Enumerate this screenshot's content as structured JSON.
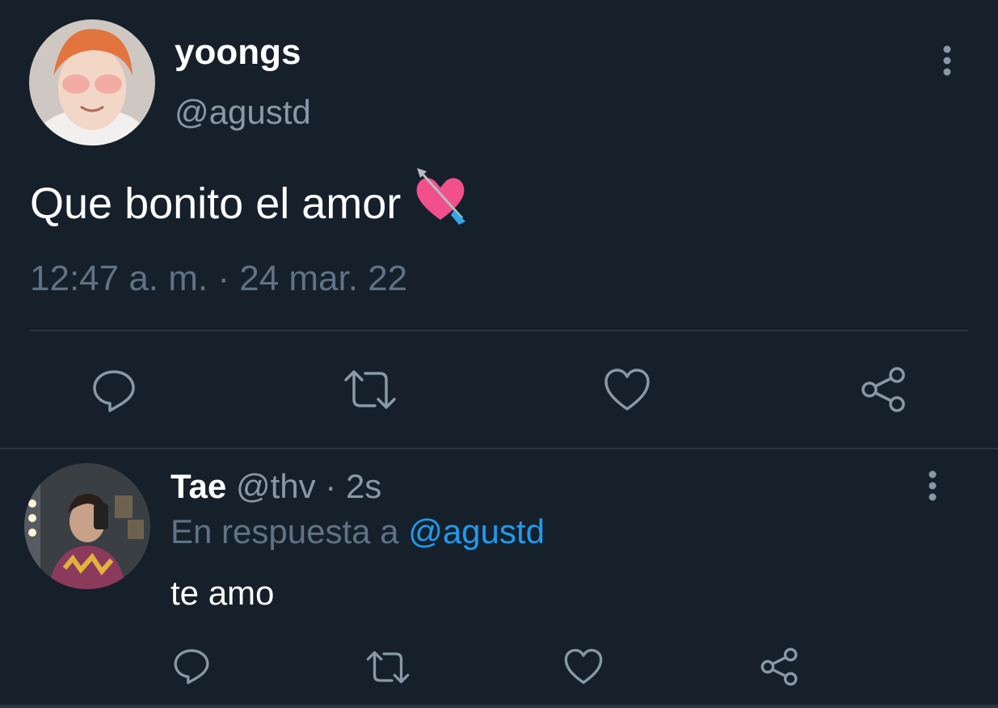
{
  "main_tweet": {
    "author_name": "yoongs",
    "author_handle": "@agustd",
    "text": "Que bonito el amor",
    "emoji": "heart-with-arrow",
    "timestamp": "12:47 a. m. · 24 mar. 22",
    "actions": [
      "reply-icon",
      "retweet-icon",
      "like-icon",
      "share-icon"
    ]
  },
  "reply_tweet": {
    "author_name": "Tae",
    "author_handle": "@thv",
    "separator": "·",
    "time": "2s",
    "in_reply_to_prefix": "En respuesta a",
    "in_reply_to_handle": "@agustd",
    "text": "te amo",
    "actions": [
      "reply-icon",
      "retweet-icon",
      "like-icon",
      "share-icon"
    ]
  },
  "colors": {
    "background": "#16202b",
    "muted": "#8899a6",
    "divider": "#2a3542",
    "accent": "#1d9bf0"
  }
}
